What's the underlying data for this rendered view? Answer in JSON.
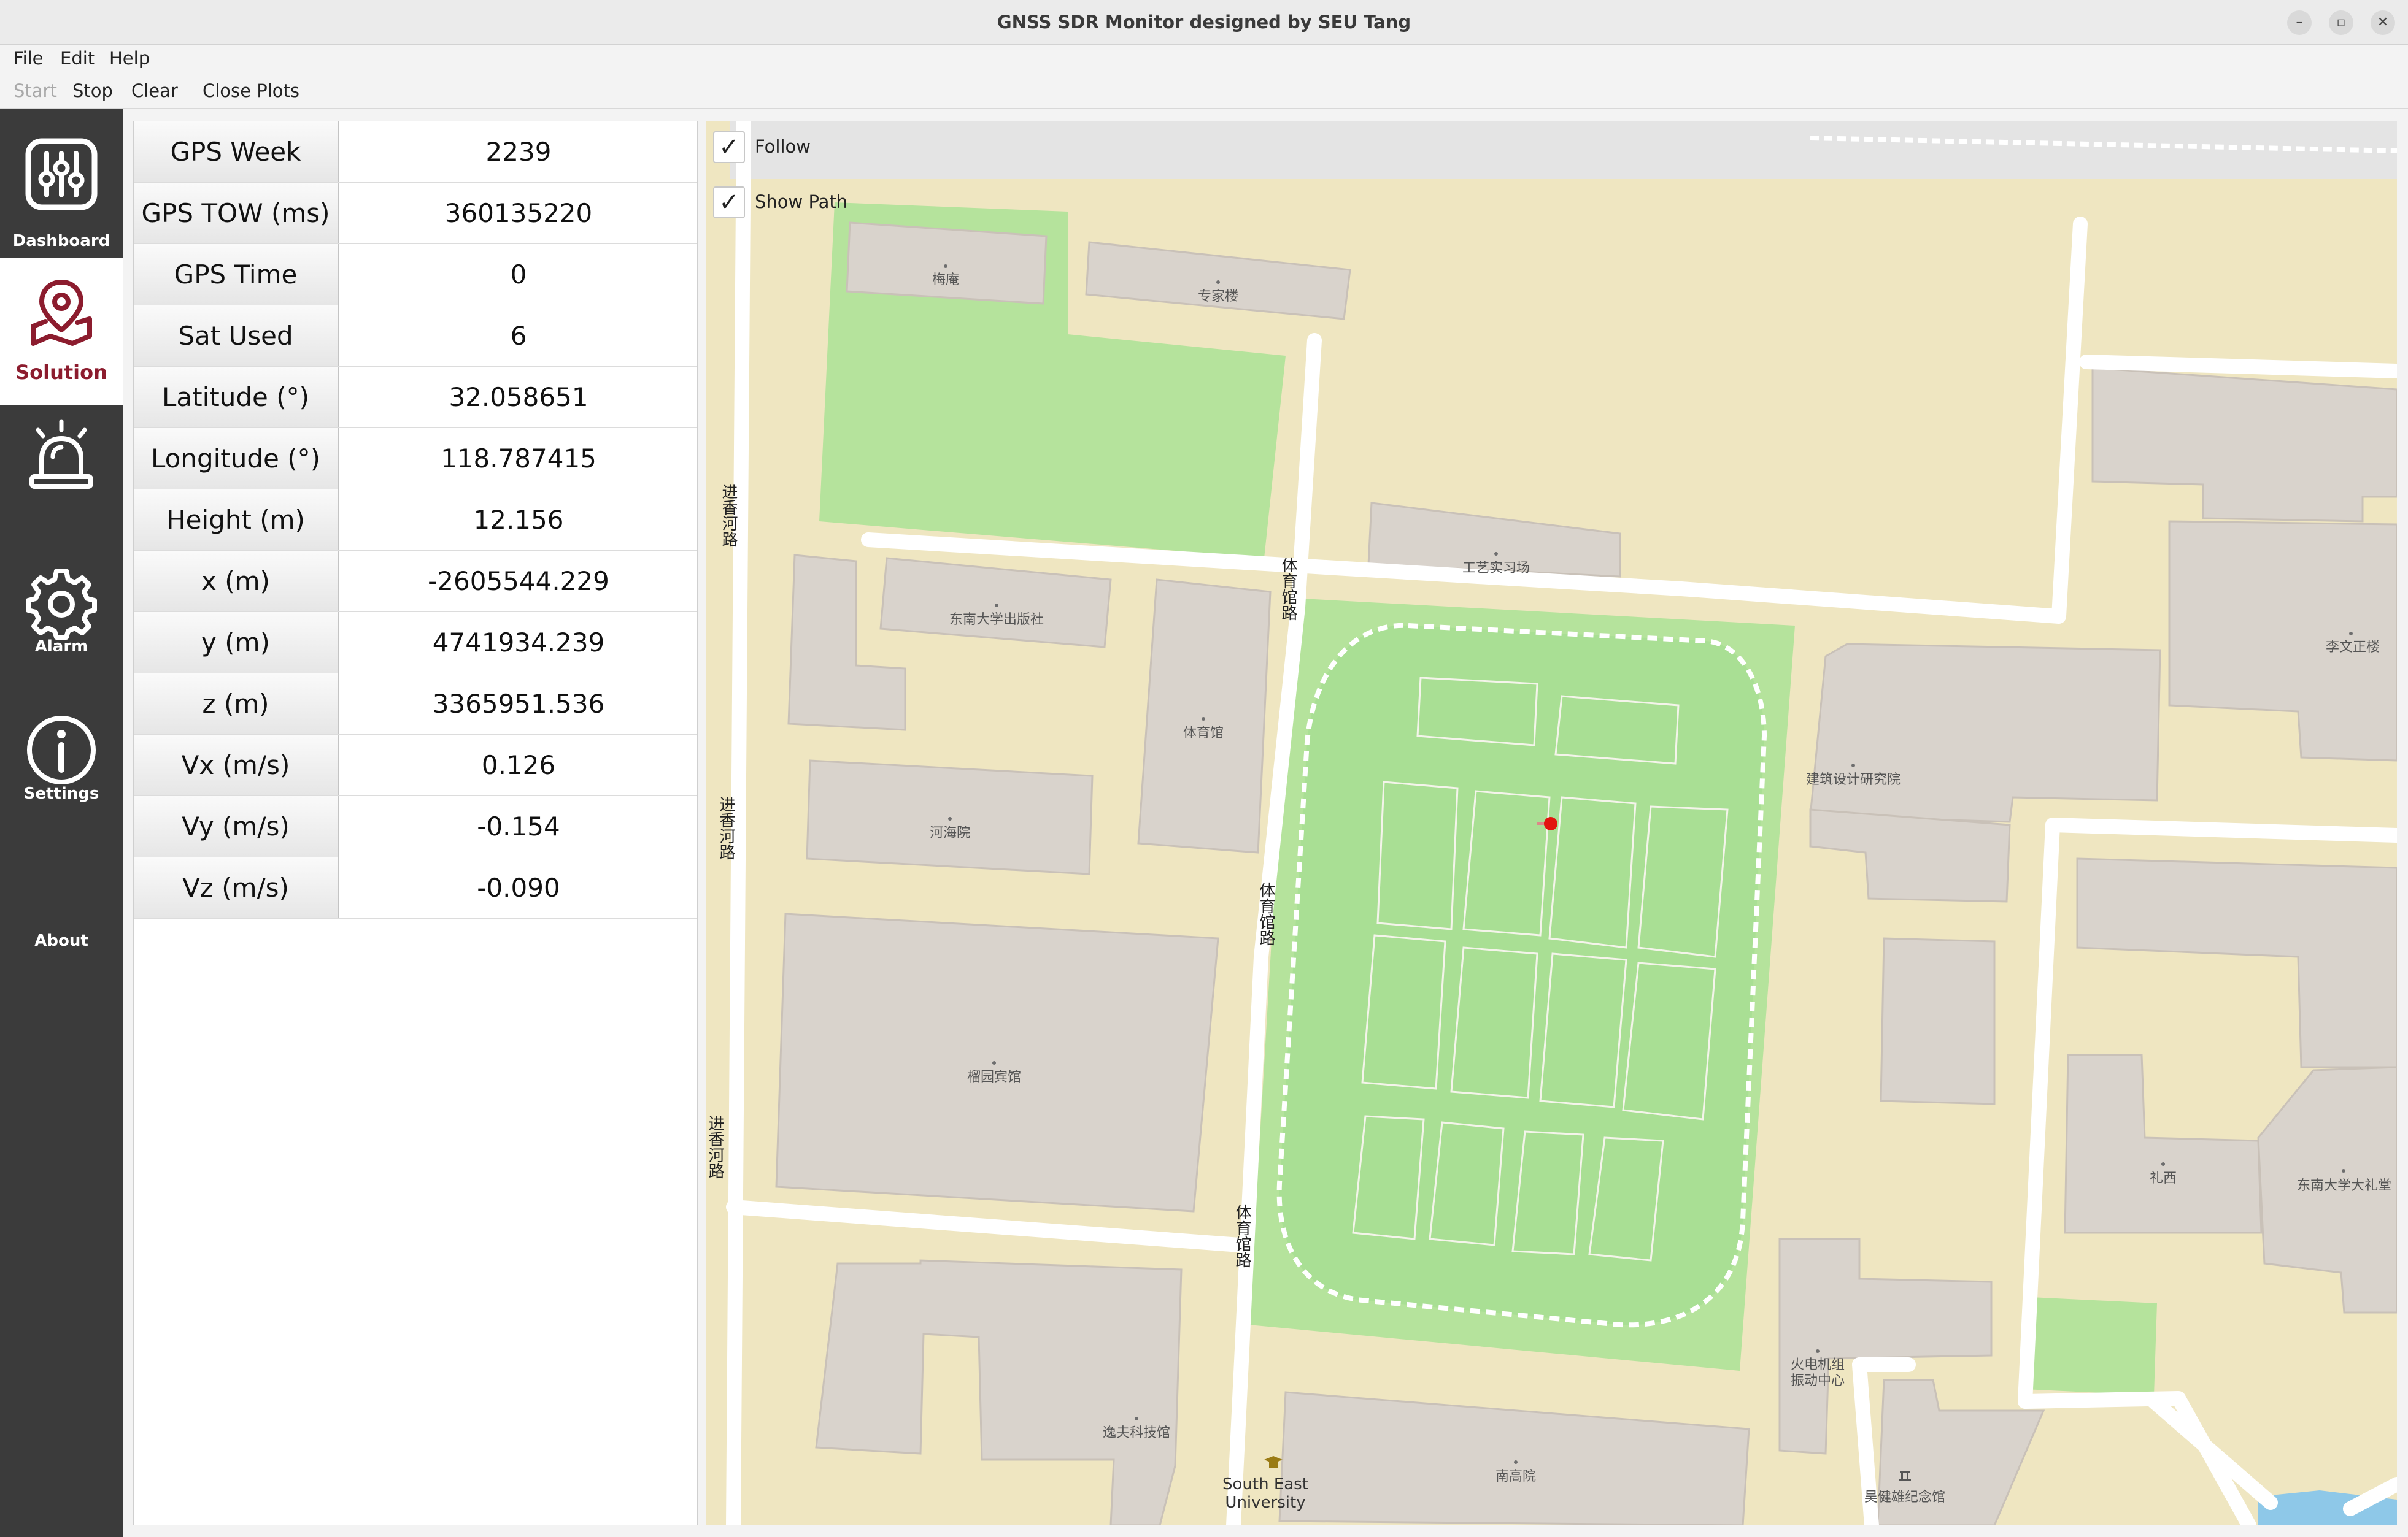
{
  "window": {
    "title": "GNSS SDR Monitor designed by SEU Tang",
    "minimize": "–",
    "maximize": "▫",
    "close": "✕"
  },
  "menu": {
    "file": "File",
    "edit": "Edit",
    "help": "Help"
  },
  "toolbar": {
    "start": "Start",
    "stop": "Stop",
    "clear": "Clear",
    "close_plots": "Close Plots"
  },
  "sidebar": {
    "dashboard": "Dashboard",
    "solution": "Solution",
    "alarm": "Alarm",
    "settings": "Settings",
    "about": "About",
    "accent": "#8c1c2e"
  },
  "solution": {
    "rows": [
      {
        "label": "GPS Week",
        "value": "2239"
      },
      {
        "label": "GPS TOW (ms)",
        "value": "360135220"
      },
      {
        "label": "GPS Time",
        "value": "0"
      },
      {
        "label": "Sat Used",
        "value": "6"
      },
      {
        "label": "Latitude (°)",
        "value": "32.058651"
      },
      {
        "label": "Longitude (°)",
        "value": "118.787415"
      },
      {
        "label": "Height (m)",
        "value": "12.156"
      },
      {
        "label": "x (m)",
        "value": "-2605544.229"
      },
      {
        "label": "y (m)",
        "value": "4741934.239"
      },
      {
        "label": "z (m)",
        "value": "3365951.536"
      },
      {
        "label": "Vx (m/s)",
        "value": "0.126"
      },
      {
        "label": "Vy (m/s)",
        "value": "-0.154"
      },
      {
        "label": "Vz (m/s)",
        "value": "-0.090"
      }
    ]
  },
  "map": {
    "follow": "Follow",
    "show_path": "Show Path",
    "check": "✓",
    "labels": {
      "meian": "梅庵",
      "zhuanjialou": "专家楼",
      "gongyi": "工艺实习场",
      "press": "东南大学出版社",
      "tiyuguan": "体育馆",
      "hehaiyuan": "河海院",
      "liyuan": "榴园宾馆",
      "yifu": "逸夫科技馆",
      "nangaoyuan": "南高院",
      "jianzhu": "建筑设计研究院",
      "liwenzheng": "李文正楼",
      "lixi": "礼西",
      "auditorium": "东南大学大礼堂",
      "huodian": "火电机组",
      "zhendong": "振动中心",
      "wujianxiong": "吴健雄纪念馆",
      "seu1": "South East",
      "seu2": "University",
      "jinxiang1": "进香河路",
      "jinxiang2": "进香河路",
      "jinxiang3": "进香河路",
      "tiyuguanlu1": "体育馆路",
      "tiyuguanlu2": "体育馆路",
      "tiyuguanlu3": "体育馆路"
    },
    "colors": {
      "background": "#efe6c1",
      "building": "#d9d3cc",
      "grass": "#b5e39c",
      "pitch": "#a9df94",
      "road": "#ffffff",
      "marker": "#e3140f"
    }
  }
}
